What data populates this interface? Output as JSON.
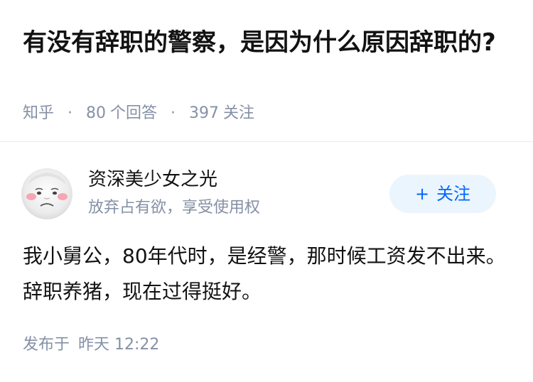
{
  "question": {
    "title": "有没有辞职的警察，是因为什么原因辞职的?",
    "meta": {
      "source": "知乎",
      "dot": "·",
      "answers_count": "80",
      "answers_label": "个回答",
      "follows_count": "397",
      "follows_label": "关注"
    }
  },
  "author": {
    "name": "资深美少女之光",
    "bio": "放弃占有欲，享受使用权",
    "avatar_icon": "cartoon-face-avatar",
    "follow_plus": "+",
    "follow_label": "关注"
  },
  "answer": {
    "content": "我小舅公，80年代时，是经警，那时候工资发不出来。辞职养猪，现在过得挺好。",
    "publish_label": "发布于",
    "publish_time": "昨天 12:22"
  },
  "colors": {
    "primary_text": "#121212",
    "secondary_text": "#8590a6",
    "accent": "#0066ff",
    "follow_bg": "#ebf5fd",
    "divider": "#ebebeb"
  }
}
